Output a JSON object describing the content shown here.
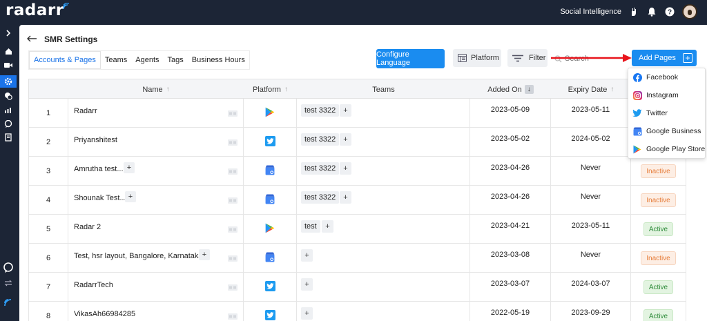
{
  "app": {
    "logo_text": "radarr",
    "product_name": "Social Intelligence"
  },
  "topbar": {
    "icons": [
      "hand-icon",
      "bell-icon",
      "help-icon",
      "avatar"
    ]
  },
  "sidebar": {
    "items": [
      "expand-icon",
      "home-icon",
      "video-icon",
      "settings-icon",
      "layers-icon",
      "analytics-icon",
      "chat-icon",
      "report-icon",
      "feedback-icon",
      "switch-icon",
      "radarr-logo-icon"
    ],
    "active": "settings-icon"
  },
  "header": {
    "title": "SMR Settings"
  },
  "tabs": [
    {
      "label": "Accounts & Pages",
      "active": true
    },
    {
      "label": "Teams",
      "active": false
    },
    {
      "label": "Agents",
      "active": false
    },
    {
      "label": "Tags",
      "active": false
    },
    {
      "label": "Business Hours",
      "active": false
    }
  ],
  "toolbar": {
    "configure_language": "Configure Language",
    "platform": "Platform",
    "filter": "Filter",
    "search_placeholder": "Search",
    "add_pages": "Add Pages"
  },
  "add_pages_menu": [
    {
      "label": "Facebook",
      "icon": "facebook-icon"
    },
    {
      "label": "Instagram",
      "icon": "instagram-icon"
    },
    {
      "label": "Twitter",
      "icon": "twitter-icon"
    },
    {
      "label": "Google Business",
      "icon": "google-business-icon"
    },
    {
      "label": "Google Play Store",
      "icon": "google-play-icon"
    }
  ],
  "table": {
    "columns": {
      "name": "Name",
      "platform": "Platform",
      "teams": "Teams",
      "added_on": "Added On",
      "expiry_date": "Expiry Date"
    },
    "rows": [
      {
        "num": "1",
        "name": "Radarr",
        "name_plus": false,
        "platform": "google-play-icon",
        "team": "test 3322",
        "added": "2023-05-09",
        "expiry": "2023-05-11",
        "status": ""
      },
      {
        "num": "2",
        "name": "Priyanshitest",
        "name_plus": false,
        "platform": "twitter-icon",
        "team": "test 3322",
        "added": "2023-05-02",
        "expiry": "2024-05-02",
        "status": ""
      },
      {
        "num": "3",
        "name": "Amrutha test...",
        "name_plus": true,
        "platform": "google-business-icon",
        "team": "test 3322",
        "added": "2023-04-26",
        "expiry": "Never",
        "status": "Inactive"
      },
      {
        "num": "4",
        "name": "Shounak Test...",
        "name_plus": true,
        "platform": "google-business-icon",
        "team": "test 3322",
        "added": "2023-04-26",
        "expiry": "Never",
        "status": "Inactive"
      },
      {
        "num": "5",
        "name": "Radar 2",
        "name_plus": false,
        "platform": "google-play-icon",
        "team": "test",
        "added": "2023-04-21",
        "expiry": "2023-05-11",
        "status": "Active"
      },
      {
        "num": "6",
        "name": "Test, hsr layout, Bangalore, Karnataka...",
        "name_plus": true,
        "platform": "google-business-icon",
        "team": "",
        "added": "2023-03-08",
        "expiry": "Never",
        "status": "Inactive"
      },
      {
        "num": "7",
        "name": "RadarrTech",
        "name_plus": false,
        "platform": "twitter-icon",
        "team": "",
        "added": "2023-03-07",
        "expiry": "2024-03-07",
        "status": "Active"
      },
      {
        "num": "8",
        "name": "VikasAh66984285",
        "name_plus": false,
        "platform": "twitter-icon",
        "team": "",
        "added": "2022-05-19",
        "expiry": "2023-09-29",
        "status": "Active"
      }
    ]
  },
  "colors": {
    "primary": "#1a8cf0",
    "dark_bg": "#1c2536",
    "active_green": "#2e8b3a",
    "inactive_orange": "#e67e3c",
    "annotation_red": "#e8141c"
  }
}
